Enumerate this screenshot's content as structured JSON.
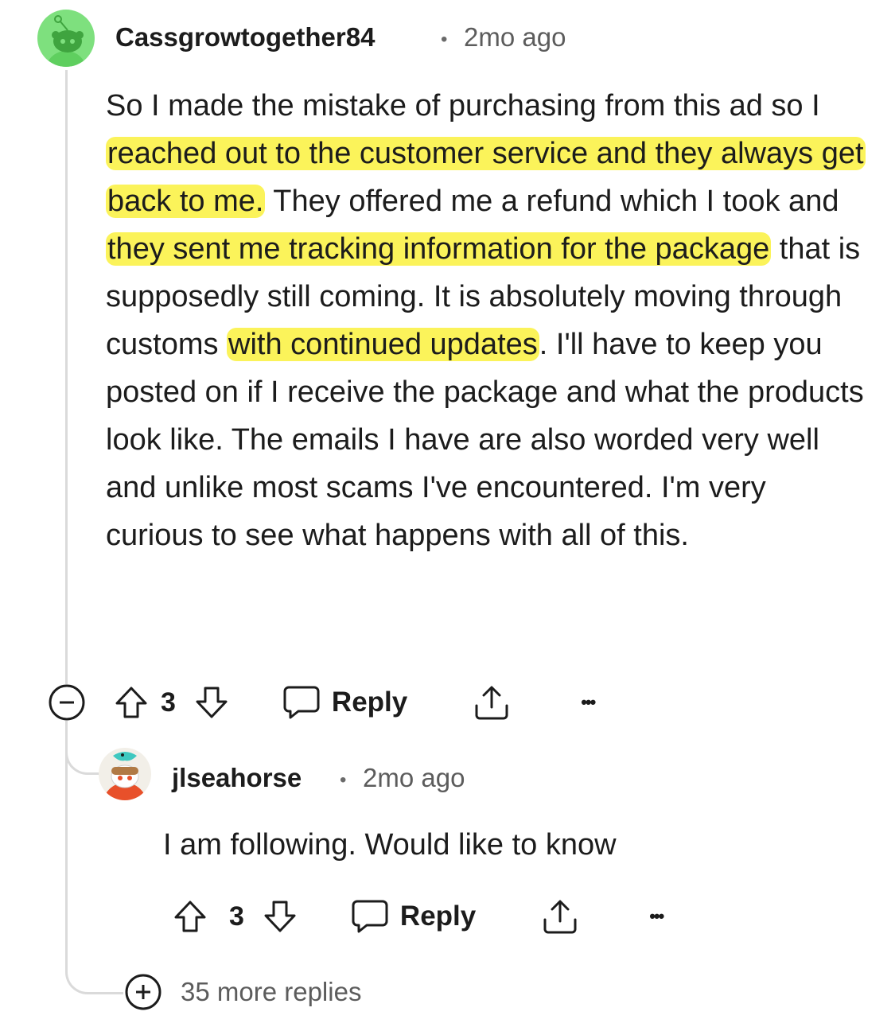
{
  "comment": {
    "username": "Cassgrowtogether84",
    "separator": "•",
    "time": "2mo ago",
    "avatar_icon": "snoo-avatar-green",
    "body": [
      {
        "text": "So I made the mistake of purchasing from this ad so I ",
        "highlight": false
      },
      {
        "text": "reached out to the customer service and they always get back to me.",
        "highlight": true
      },
      {
        "text": " They offered me a refund which I took and ",
        "highlight": false
      },
      {
        "text": "they sent me tracking information for the package",
        "highlight": true
      },
      {
        "text": " that is supposedly still coming. It is absolutely moving through customs ",
        "highlight": false
      },
      {
        "text": "with continued updates",
        "highlight": true
      },
      {
        "text": ". I'll have to keep you posted on if I receive the package and what the products look like. The emails I have are also worded very well and unlike most scams I've encountered. I'm very curious to see what happens with all of this.",
        "highlight": false
      }
    ],
    "score": "3",
    "reply_label": "Reply",
    "more_glyph": "•••"
  },
  "reply": {
    "username": "jlseahorse",
    "separator": "•",
    "time": "2mo ago",
    "avatar_icon": "snoo-avatar-seahorse",
    "body": "I am following. Would like to know",
    "score": "3",
    "reply_label": "Reply",
    "more_glyph": "•••"
  },
  "more_replies": {
    "label": "35 more replies"
  },
  "colors": {
    "highlight": "#fbf35a",
    "avatar_green": "#7ee07e",
    "thread_line": "#dadada"
  }
}
